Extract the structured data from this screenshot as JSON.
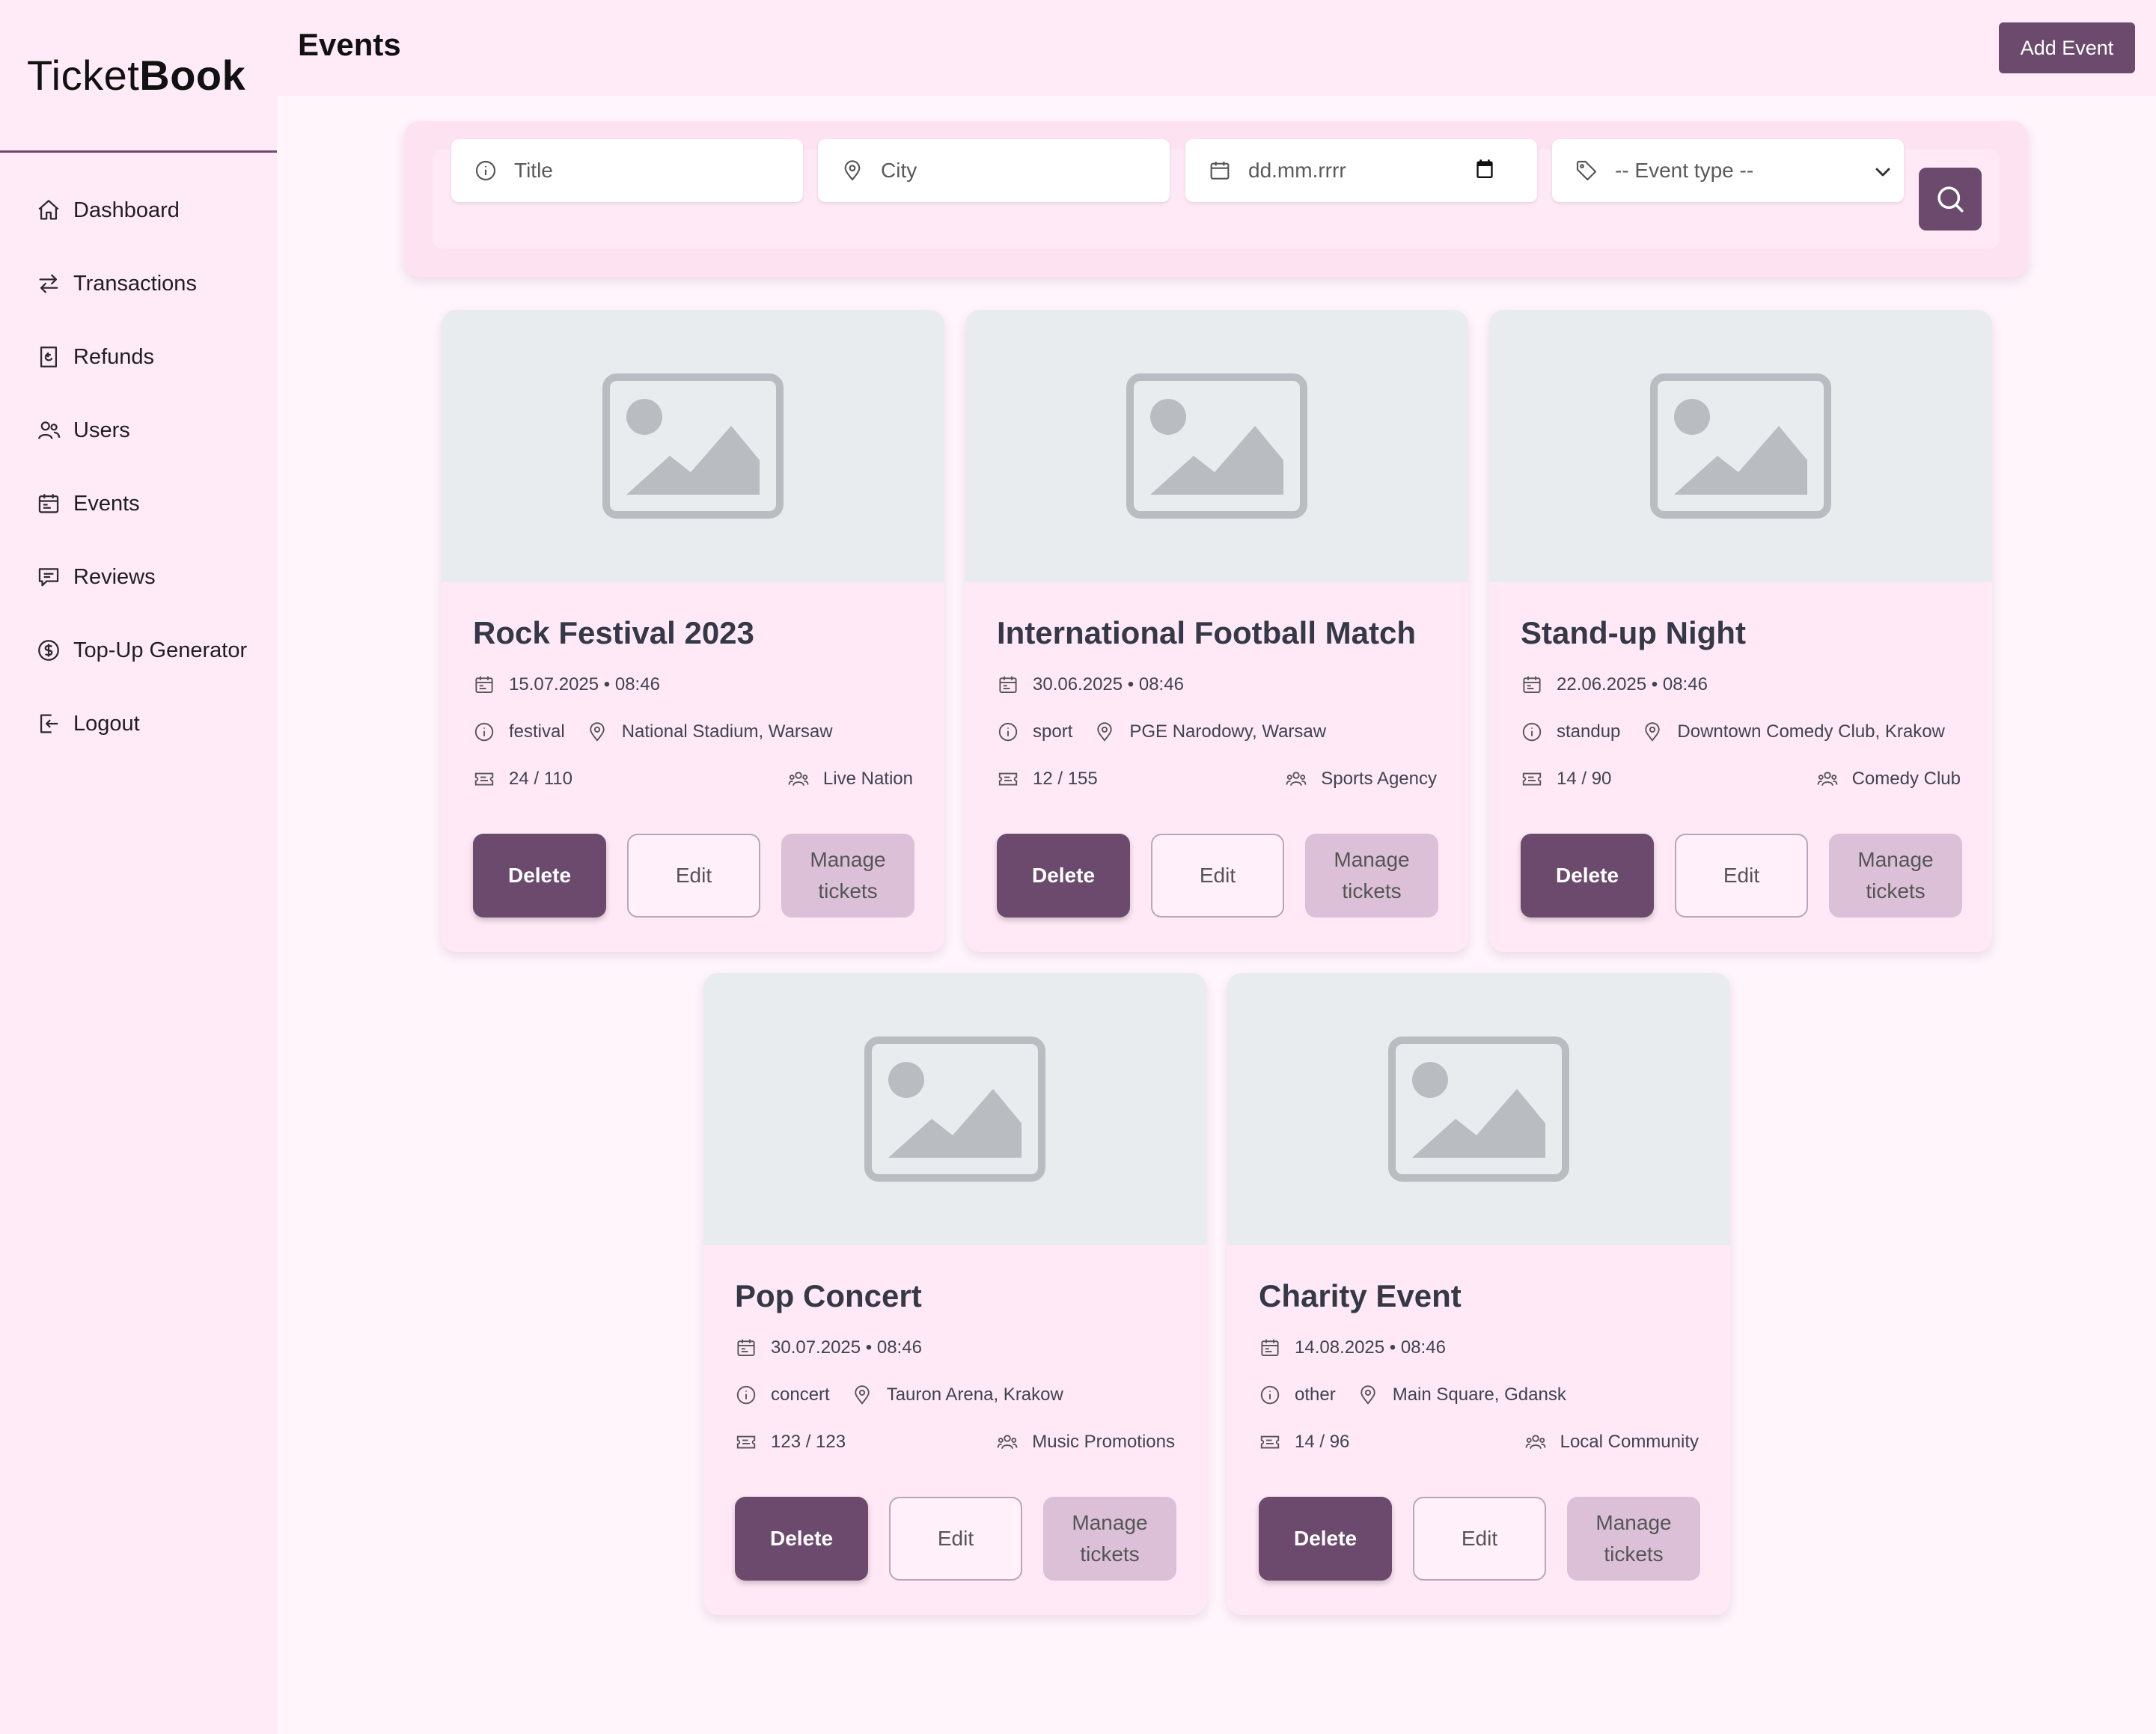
{
  "app": {
    "brand_light": "Ticket",
    "brand_bold": "Book",
    "accent_color": "#6b4a6e"
  },
  "sidebar": {
    "items": [
      {
        "label": "Dashboard",
        "icon": "home-icon"
      },
      {
        "label": "Transactions",
        "icon": "arrows-swap-icon"
      },
      {
        "label": "Refunds",
        "icon": "receipt-refund-icon"
      },
      {
        "label": "Users",
        "icon": "users-icon"
      },
      {
        "label": "Events",
        "icon": "calendar-icon"
      },
      {
        "label": "Reviews",
        "icon": "chat-bubble-icon"
      },
      {
        "label": "Top-Up Generator",
        "icon": "dollar-circle-icon"
      },
      {
        "label": "Logout",
        "icon": "logout-icon"
      }
    ]
  },
  "header": {
    "title": "Events",
    "add_button": "Add Event"
  },
  "filters": {
    "title_placeholder": "Title",
    "city_placeholder": "City",
    "date_placeholder": "dd.mm.rrrr",
    "type_selected": "-- Event type --"
  },
  "events": [
    {
      "title": "Rock Festival 2023",
      "datetime": "15.07.2025 • 08:46",
      "type": "festival",
      "location": "National Stadium, Warsaw",
      "tickets": "24 / 110",
      "organizer": "Live Nation"
    },
    {
      "title": "International Football Match",
      "datetime": "30.06.2025 • 08:46",
      "type": "sport",
      "location": "PGE Narodowy, Warsaw",
      "tickets": "12 / 155",
      "organizer": "Sports Agency"
    },
    {
      "title": "Stand-up Night",
      "datetime": "22.06.2025 • 08:46",
      "type": "standup",
      "location": "Downtown Comedy Club, Krakow",
      "tickets": "14 / 90",
      "organizer": "Comedy Club"
    },
    {
      "title": "Pop Concert",
      "datetime": "30.07.2025 • 08:46",
      "type": "concert",
      "location": "Tauron Arena, Krakow",
      "tickets": "123 / 123",
      "organizer": "Music Promotions"
    },
    {
      "title": "Charity Event",
      "datetime": "14.08.2025 • 08:46",
      "type": "other",
      "location": "Main Square, Gdansk",
      "tickets": "14 / 96",
      "organizer": "Local Community"
    }
  ],
  "card_buttons": {
    "delete": "Delete",
    "edit": "Edit",
    "manage": "Manage tickets"
  }
}
